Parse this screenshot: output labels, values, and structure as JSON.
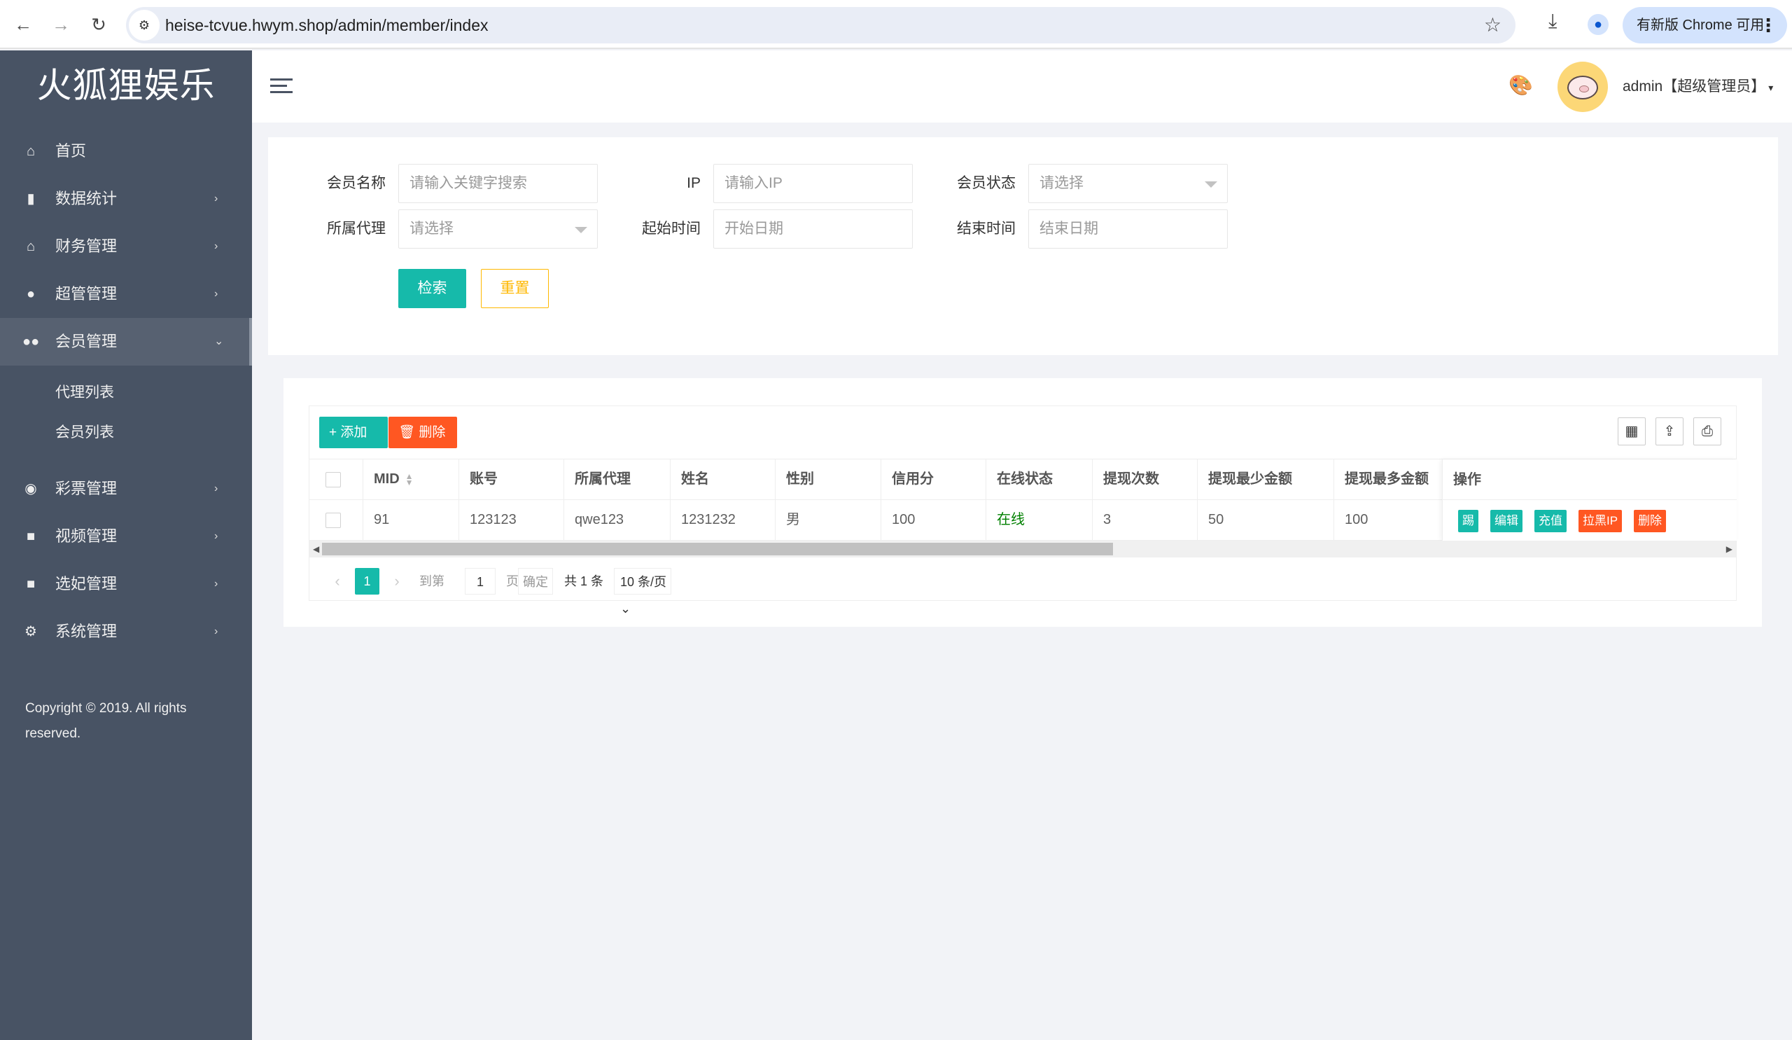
{
  "browser": {
    "url": "heise-tcvue.hwym.shop/admin/member/index",
    "update_label": "有新版 Chrome 可用",
    "back_icon": "arrow-left-icon",
    "forward_icon": "arrow-right-icon",
    "reload_icon": "reload-icon"
  },
  "sidebar": {
    "logo": "火狐狸娱乐",
    "items": [
      {
        "label": "首页",
        "icon": "home-icon",
        "glyph": "⌂",
        "arrow": ""
      },
      {
        "label": "数据统计",
        "icon": "bar-chart-icon",
        "glyph": "▮",
        "arrow": "›"
      },
      {
        "label": "财务管理",
        "icon": "bank-icon",
        "glyph": "⌂",
        "arrow": "›"
      },
      {
        "label": "超管管理",
        "icon": "user-icon",
        "glyph": "●",
        "arrow": "›"
      },
      {
        "label": "会员管理",
        "icon": "users-icon",
        "glyph": "●●",
        "arrow": "⌄",
        "active": true
      },
      {
        "label": "彩票管理",
        "icon": "gamepad-icon",
        "glyph": "◉",
        "arrow": "›"
      },
      {
        "label": "视频管理",
        "icon": "video-icon",
        "glyph": "■",
        "arrow": "›"
      },
      {
        "label": "选妃管理",
        "icon": "video-icon",
        "glyph": "■",
        "arrow": "›"
      },
      {
        "label": "系统管理",
        "icon": "gear-icon",
        "glyph": "⚙",
        "arrow": "›"
      }
    ],
    "submenu": [
      "代理列表",
      "会员列表"
    ],
    "copyright": "Copyright © 2019. All rights reserved."
  },
  "header": {
    "user": "admin【超级管理员】",
    "caret": "▾"
  },
  "search": {
    "fields": [
      {
        "label": "会员名称",
        "placeholder": "请输入关键字搜索",
        "type": "input"
      },
      {
        "label": "IP",
        "placeholder": "请输入IP",
        "type": "input"
      },
      {
        "label": "会员状态",
        "placeholder": "请选择",
        "type": "select"
      },
      {
        "label": "所属代理",
        "placeholder": "请选择",
        "type": "select"
      },
      {
        "label": "起始时间",
        "placeholder": "开始日期",
        "type": "date"
      },
      {
        "label": "结束时间",
        "placeholder": "结束日期",
        "type": "date"
      }
    ],
    "search_label": "检索",
    "reset_label": "重置"
  },
  "table": {
    "add_label": "+ 添加",
    "delete_label": "🗑 删除",
    "columns": [
      "MID",
      "账号",
      "所属代理",
      "姓名",
      "性别",
      "信用分",
      "在线状态",
      "提现次数",
      "提现最少金额",
      "提现最多金额",
      "操作"
    ],
    "rows": [
      {
        "mid": "91",
        "account": "123123",
        "agent": "qwe123",
        "name": "1231232",
        "gender": "男",
        "credit": "100",
        "status": "在线",
        "withdraw_count": "3",
        "withdraw_min": "50",
        "withdraw_max": "100"
      }
    ],
    "actions": [
      {
        "label": "踢",
        "color": "green"
      },
      {
        "label": "编辑",
        "color": "green"
      },
      {
        "label": "充值",
        "color": "green"
      },
      {
        "label": "拉黑IP",
        "color": "red"
      },
      {
        "label": "删除",
        "color": "red"
      }
    ],
    "tools": [
      "columns-icon",
      "export-icon",
      "print-icon"
    ]
  },
  "pagination": {
    "prev": "‹",
    "current": "1",
    "next": "›",
    "goto_label": "到第",
    "goto_value": "1",
    "page_label": "页",
    "confirm_label": "确定",
    "total": "共 1 条",
    "page_size": "10 条/页"
  },
  "colors": {
    "primary": "#16baaa",
    "danger": "#ff5722",
    "warning": "#ffb800",
    "sidebar": "#485364"
  }
}
